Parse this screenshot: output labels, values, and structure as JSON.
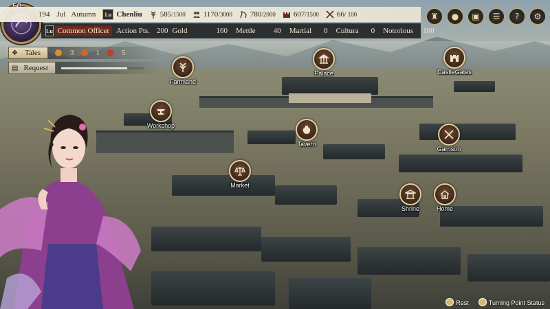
{
  "player": {
    "level": "50"
  },
  "date": {
    "year": "194",
    "month": "Jul",
    "season": "Autumn"
  },
  "city": {
    "badge": "Lu",
    "name": "Chenliu"
  },
  "resources": [
    {
      "icon": "grain-icon",
      "value": "585",
      "max": "/1500"
    },
    {
      "icon": "population-icon",
      "value": "1170",
      "max": "/3000"
    },
    {
      "icon": "horse-icon",
      "value": "780",
      "max": "/2000"
    },
    {
      "icon": "fortress-icon",
      "value": "607",
      "max": "/1500"
    },
    {
      "icon": "swords-icon",
      "value": "66",
      "max": "/ 100"
    }
  ],
  "status": {
    "rank_badge": "Lu",
    "rank": "Common Officer",
    "action_label": "Action Pts.",
    "action_value": "200",
    "gold_label": "Gold",
    "gold_value": "160",
    "mettle_label": "Mettle",
    "mettle_value": "40",
    "martial_label": "Martial",
    "martial_value": "0",
    "cultura_label": "Cultura",
    "cultura_value": "0",
    "notorious_label": "Notorious",
    "notorious_value": "100"
  },
  "system_icons": [
    "faction-icon",
    "character-icon",
    "camera-icon",
    "list-icon",
    "help-icon",
    "settings-icon"
  ],
  "panel": {
    "tales_label": "Tales",
    "tales_counts": [
      "3",
      "1",
      "5"
    ],
    "request_label": "Request",
    "request_progress": 0.8
  },
  "locations": {
    "farmland": "Farmland",
    "palace": "Palace",
    "castle_gates": "CastleGates",
    "workshop": "Workshop",
    "tavern": "Tavern",
    "garrison": "Garrison",
    "market": "Market",
    "shrine": "Shrine",
    "home": "Home"
  },
  "footer": {
    "rest": "Rest",
    "turning": "Turning Point Status"
  },
  "colors": {
    "accent": "#c8a560",
    "marker": "#5a3a2a"
  }
}
